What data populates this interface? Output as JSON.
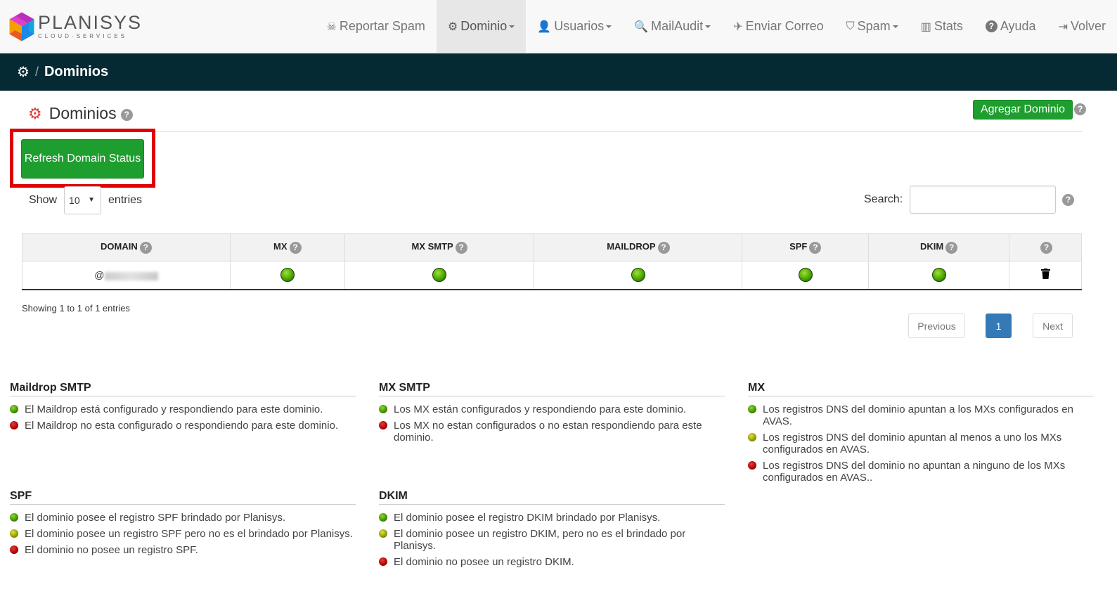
{
  "brand": {
    "name": "PLANISYS",
    "tagline": "CLOUD·SERVICES"
  },
  "nav": [
    {
      "label": "Reportar Spam",
      "icon": "skull-icon",
      "glyph": "☠",
      "caret": false
    },
    {
      "label": "Dominio",
      "icon": "gear-icon",
      "glyph": "⚙",
      "caret": true,
      "active": true
    },
    {
      "label": "Usuarios",
      "icon": "user-icon",
      "glyph": "👤",
      "caret": true
    },
    {
      "label": "MailAudit",
      "icon": "search-icon",
      "glyph": "🔍",
      "caret": true
    },
    {
      "label": "Enviar Correo",
      "icon": "paper-plane-icon",
      "glyph": "✈",
      "caret": false
    },
    {
      "label": "Spam",
      "icon": "shield-icon",
      "glyph": "⛉",
      "caret": true
    },
    {
      "label": "Stats",
      "icon": "bar-chart-icon",
      "glyph": "▥",
      "caret": false
    },
    {
      "label": "Ayuda",
      "icon": "question-circle-icon",
      "glyph": "?",
      "caret": false
    },
    {
      "label": "Volver",
      "icon": "sign-in-icon",
      "glyph": "⇥",
      "caret": false
    }
  ],
  "breadcrumb": {
    "separator": "/",
    "current": "Dominios"
  },
  "page": {
    "title": "Dominios",
    "add_button": "Agregar Dominio",
    "refresh_button": "Refresh Domain Status"
  },
  "table_controls": {
    "show_label": "Show",
    "entries_value": "10",
    "entries_label": "entries",
    "search_label": "Search:",
    "search_value": ""
  },
  "table": {
    "columns": [
      "DOMAIN",
      "MX",
      "MX SMTP",
      "MAILDROP",
      "SPF",
      "DKIM",
      ""
    ],
    "rows": [
      {
        "domain_prefix": "@",
        "mx": "green",
        "mx_smtp": "green",
        "maildrop": "green",
        "spf": "green",
        "dkim": "green"
      }
    ]
  },
  "pagination": {
    "info": "Showing 1 to 1 of 1 entries",
    "previous": "Previous",
    "current_page": "1",
    "next": "Next"
  },
  "legend": {
    "maildrop": {
      "title": "Maildrop SMTP",
      "items": [
        {
          "status": "green",
          "text": "El Maildrop está configurado y respondiendo para este dominio."
        },
        {
          "status": "red",
          "text": "El Maildrop no esta configurado o respondiendo para este dominio."
        }
      ]
    },
    "mx_smtp": {
      "title": "MX SMTP",
      "items": [
        {
          "status": "green",
          "text": "Los MX están configurados y respondiendo para este dominio."
        },
        {
          "status": "red",
          "text": "Los MX no estan configurados o no estan respondiendo para este dominio."
        }
      ]
    },
    "mx": {
      "title": "MX",
      "items": [
        {
          "status": "green",
          "text": "Los registros DNS del dominio apuntan a los MXs configurados en AVAS."
        },
        {
          "status": "yellow",
          "text": "Los registros DNS del dominio apuntan al menos a uno los MXs configurados en AVAS."
        },
        {
          "status": "red",
          "text": "Los registros DNS del dominio no apuntan a ninguno de los MXs configurados en AVAS.."
        }
      ]
    },
    "spf": {
      "title": "SPF",
      "items": [
        {
          "status": "green",
          "text": "El dominio posee el registro SPF brindado por Planisys."
        },
        {
          "status": "yellow",
          "text": "El dominio posee un registro SPF pero no es el brindado por Planisys."
        },
        {
          "status": "red",
          "text": "El dominio no posee un registro SPF."
        }
      ]
    },
    "dkim": {
      "title": "DKIM",
      "items": [
        {
          "status": "green",
          "text": "El dominio posee el registro DKIM brindado por Planisys."
        },
        {
          "status": "yellow",
          "text": "El dominio posee un registro DKIM, pero no es el brindado por Planisys."
        },
        {
          "status": "red",
          "text": "El dominio no posee un registro DKIM."
        }
      ]
    }
  }
}
